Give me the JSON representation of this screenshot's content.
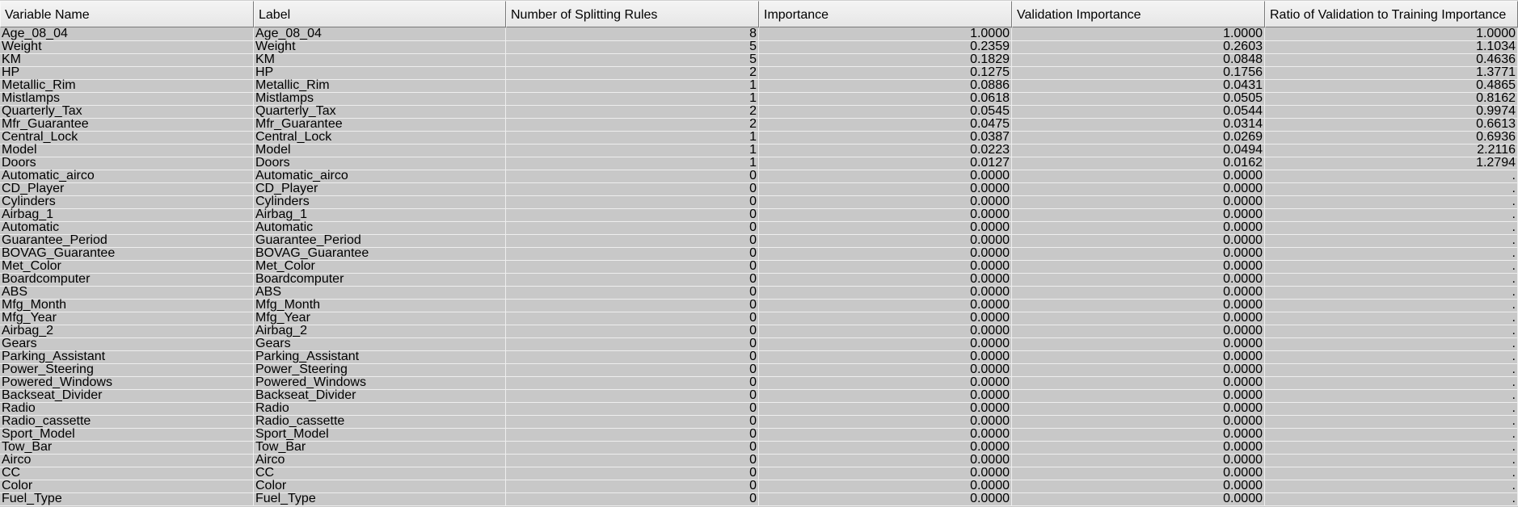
{
  "table": {
    "columns": [
      "Variable Name",
      "Label",
      "Number of Splitting Rules",
      "Importance",
      "Validation Importance",
      "Ratio of Validation to Training Importance"
    ],
    "rows": [
      [
        "Age_08_04",
        "Age_08_04",
        "8",
        "1.0000",
        "1.0000",
        "1.0000"
      ],
      [
        "Weight",
        "Weight",
        "5",
        "0.2359",
        "0.2603",
        "1.1034"
      ],
      [
        "KM",
        "KM",
        "5",
        "0.1829",
        "0.0848",
        "0.4636"
      ],
      [
        "HP",
        "HP",
        "2",
        "0.1275",
        "0.1756",
        "1.3771"
      ],
      [
        "Metallic_Rim",
        "Metallic_Rim",
        "1",
        "0.0886",
        "0.0431",
        "0.4865"
      ],
      [
        "Mistlamps",
        "Mistlamps",
        "1",
        "0.0618",
        "0.0505",
        "0.8162"
      ],
      [
        "Quarterly_Tax",
        "Quarterly_Tax",
        "2",
        "0.0545",
        "0.0544",
        "0.9974"
      ],
      [
        "Mfr_Guarantee",
        "Mfr_Guarantee",
        "2",
        "0.0475",
        "0.0314",
        "0.6613"
      ],
      [
        "Central_Lock",
        "Central_Lock",
        "1",
        "0.0387",
        "0.0269",
        "0.6936"
      ],
      [
        "Model",
        "Model",
        "1",
        "0.0223",
        "0.0494",
        "2.2116"
      ],
      [
        "Doors",
        "Doors",
        "1",
        "0.0127",
        "0.0162",
        "1.2794"
      ],
      [
        "Automatic_airco",
        "Automatic_airco",
        "0",
        "0.0000",
        "0.0000",
        "."
      ],
      [
        "CD_Player",
        "CD_Player",
        "0",
        "0.0000",
        "0.0000",
        "."
      ],
      [
        "Cylinders",
        "Cylinders",
        "0",
        "0.0000",
        "0.0000",
        "."
      ],
      [
        "Airbag_1",
        "Airbag_1",
        "0",
        "0.0000",
        "0.0000",
        "."
      ],
      [
        "Automatic",
        "Automatic",
        "0",
        "0.0000",
        "0.0000",
        "."
      ],
      [
        "Guarantee_Period",
        "Guarantee_Period",
        "0",
        "0.0000",
        "0.0000",
        "."
      ],
      [
        "BOVAG_Guarantee",
        "BOVAG_Guarantee",
        "0",
        "0.0000",
        "0.0000",
        "."
      ],
      [
        "Met_Color",
        "Met_Color",
        "0",
        "0.0000",
        "0.0000",
        "."
      ],
      [
        "Boardcomputer",
        "Boardcomputer",
        "0",
        "0.0000",
        "0.0000",
        "."
      ],
      [
        "ABS",
        "ABS",
        "0",
        "0.0000",
        "0.0000",
        "."
      ],
      [
        "Mfg_Month",
        "Mfg_Month",
        "0",
        "0.0000",
        "0.0000",
        "."
      ],
      [
        "Mfg_Year",
        "Mfg_Year",
        "0",
        "0.0000",
        "0.0000",
        "."
      ],
      [
        "Airbag_2",
        "Airbag_2",
        "0",
        "0.0000",
        "0.0000",
        "."
      ],
      [
        "Gears",
        "Gears",
        "0",
        "0.0000",
        "0.0000",
        "."
      ],
      [
        "Parking_Assistant",
        "Parking_Assistant",
        "0",
        "0.0000",
        "0.0000",
        "."
      ],
      [
        "Power_Steering",
        "Power_Steering",
        "0",
        "0.0000",
        "0.0000",
        "."
      ],
      [
        "Powered_Windows",
        "Powered_Windows",
        "0",
        "0.0000",
        "0.0000",
        "."
      ],
      [
        "Backseat_Divider",
        "Backseat_Divider",
        "0",
        "0.0000",
        "0.0000",
        "."
      ],
      [
        "Radio",
        "Radio",
        "0",
        "0.0000",
        "0.0000",
        "."
      ],
      [
        "Radio_cassette",
        "Radio_cassette",
        "0",
        "0.0000",
        "0.0000",
        "."
      ],
      [
        "Sport_Model",
        "Sport_Model",
        "0",
        "0.0000",
        "0.0000",
        "."
      ],
      [
        "Tow_Bar",
        "Tow_Bar",
        "0",
        "0.0000",
        "0.0000",
        "."
      ],
      [
        "Airco",
        "Airco",
        "0",
        "0.0000",
        "0.0000",
        "."
      ],
      [
        "CC",
        "CC",
        "0",
        "0.0000",
        "0.0000",
        "."
      ],
      [
        "Color",
        "Color",
        "0",
        "0.0000",
        "0.0000",
        "."
      ],
      [
        "Fuel_Type",
        "Fuel_Type",
        "0",
        "0.0000",
        "0.0000",
        "."
      ]
    ]
  },
  "colors": {
    "row_background": "#c8c8c8",
    "header_background": "#ececec",
    "grid_line": "#eeeeee"
  }
}
